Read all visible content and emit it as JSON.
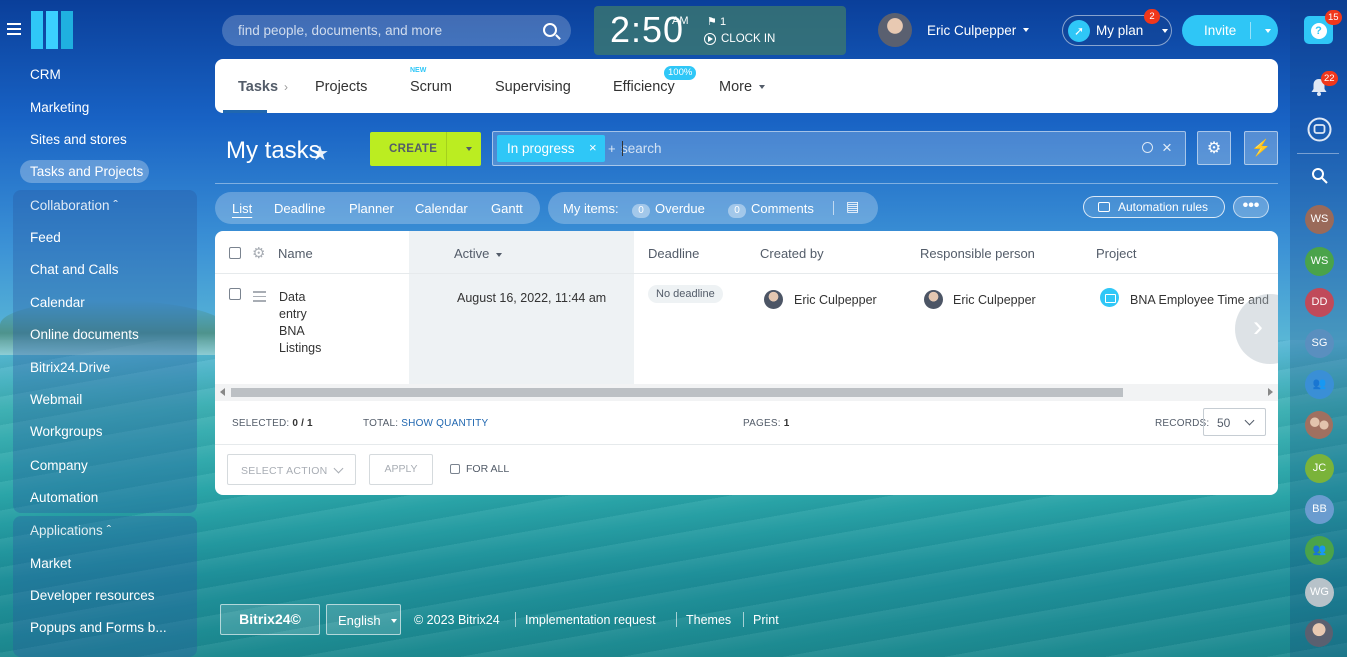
{
  "left_menu": {
    "items": [
      "CRM",
      "Marketing",
      "Sites and stores",
      "Tasks and Projects"
    ],
    "collaboration": {
      "title": "Collaboration",
      "items": [
        "Feed",
        "Chat and Calls",
        "Calendar",
        "Online documents",
        "Bitrix24.Drive",
        "Webmail",
        "Workgroups",
        "Company",
        "Automation"
      ]
    },
    "applications": {
      "title": "Applications",
      "items": [
        "Market",
        "Developer resources",
        "Popups and Forms b..."
      ]
    }
  },
  "header": {
    "search_placeholder": "find people, documents, and more",
    "clock": {
      "time": "2:50",
      "ampm": "AM",
      "flag_count": "1",
      "clock_in": "CLOCK IN"
    },
    "user_name": "Eric Culpepper",
    "my_plan": "My plan",
    "my_plan_badge": "2",
    "invite": "Invite"
  },
  "right_bar": {
    "help_badge": "15",
    "notifications_badge": "22",
    "contacts": [
      {
        "initials": "WS",
        "color": "#9a6a5a"
      },
      {
        "initials": "WS",
        "color": "#4aa34a"
      },
      {
        "initials": "DD",
        "color": "#c04a5a"
      },
      {
        "initials": "SG",
        "color": "#5a8fbf"
      },
      {
        "initials": "JC",
        "color": "#7ab33a"
      },
      {
        "initials": "BB",
        "color": "#6a9ccf"
      },
      {
        "initials": "WG",
        "color": "#b7c2c9"
      }
    ]
  },
  "tabs": {
    "items": [
      "Tasks",
      "Projects",
      "Scrum",
      "Supervising",
      "Efficiency",
      "More"
    ],
    "scrum_new": "NEW",
    "efficiency_pct": "100%"
  },
  "toolbar": {
    "title": "My tasks",
    "create": "CREATE",
    "filter_pill": "In progress",
    "filter_placeholder": "search",
    "plus": "+"
  },
  "views": {
    "items": [
      "List",
      "Deadline",
      "Planner",
      "Calendar",
      "Gantt"
    ],
    "my_items_label": "My items:",
    "overdue_count": "0",
    "overdue_label": "Overdue",
    "comments_count": "0",
    "comments_label": "Comments",
    "automation_rules": "Automation rules"
  },
  "grid": {
    "columns": [
      "Name",
      "Active",
      "Deadline",
      "Created by",
      "Responsible person",
      "Project"
    ],
    "rows": [
      {
        "name_lines": [
          "Data",
          "entry",
          "BNA",
          "Listings"
        ],
        "active": "August 16, 2022, 11:44 am",
        "deadline": "No deadline",
        "created_by": "Eric Culpepper",
        "responsible": "Eric Culpepper",
        "project": "BNA Employee Time and"
      }
    ],
    "footer": {
      "selected_label": "SELECTED:",
      "selected_value": "0 / 1",
      "total_label": "TOTAL:",
      "total_link": "SHOW QUANTITY",
      "pages_label": "PAGES:",
      "pages_value": "1",
      "records_label": "RECORDS:",
      "records_value": "50"
    },
    "actions": {
      "select_action": "SELECT ACTION",
      "apply": "APPLY",
      "for_all": "FOR ALL"
    }
  },
  "footer": {
    "brand": "Bitrix24©",
    "language": "English",
    "copyright": "© 2023 Bitrix24",
    "links": [
      "Implementation request",
      "Themes",
      "Print"
    ]
  }
}
